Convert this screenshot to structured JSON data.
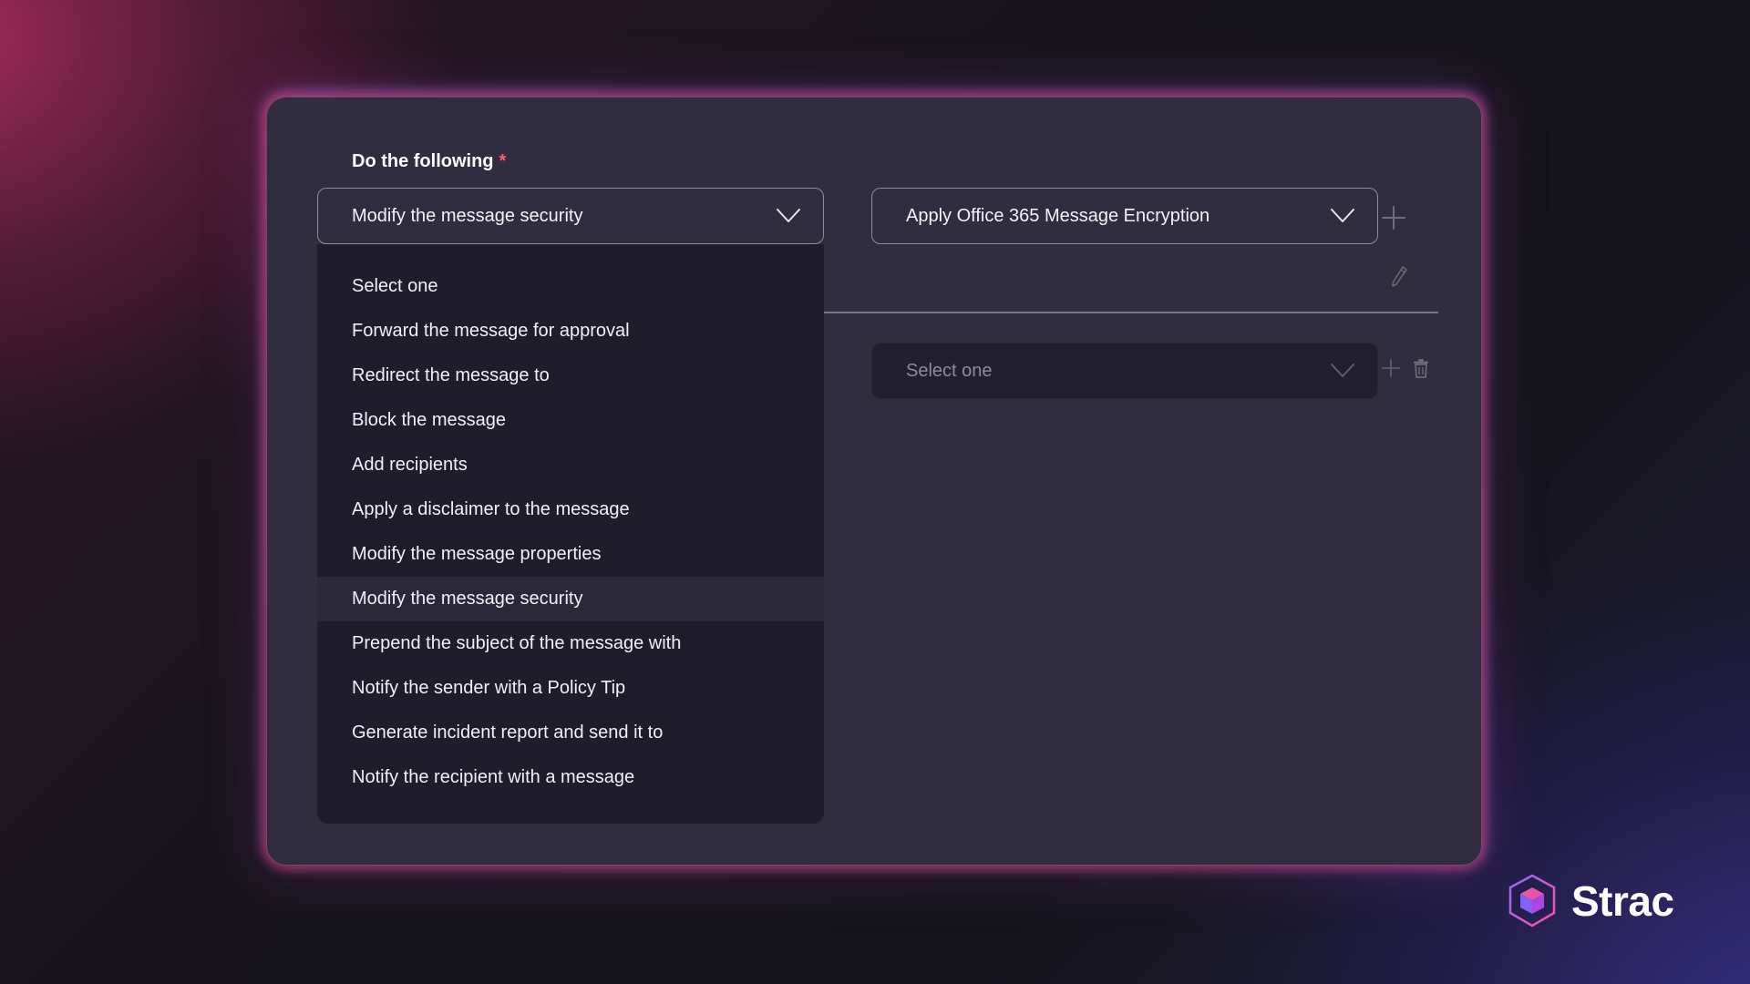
{
  "form": {
    "section_label": "Do the following",
    "required_marker": "*",
    "action_select": {
      "value": "Modify the message security",
      "state": "expanded"
    },
    "sub_action_select": {
      "value": "Apply Office 365 Message Encryption"
    },
    "empty_select": {
      "placeholder": "Select one"
    }
  },
  "dropdown": {
    "selected_index": 7,
    "items": [
      "Select one",
      "Forward the message for approval",
      "Redirect the message to",
      "Block the message",
      "Add recipients",
      "Apply a disclaimer to the message",
      "Modify the message properties",
      "Modify the message security",
      "Prepend the subject of the message with",
      "Notify the sender with a Policy Tip",
      "Generate incident report and send it to",
      "Notify the recipient with a message"
    ]
  },
  "icons": {
    "chevron": "chevron-down-icon",
    "add": "plus-icon",
    "edit": "pencil-icon",
    "delete": "trash-icon",
    "brand": "strac-logo"
  },
  "brand": {
    "name": "Strac"
  },
  "colors": {
    "card_background": "#302d40",
    "dropdown_background": "#1f1d2b",
    "selected_item": "#2a2839",
    "required": "#ff5a6e",
    "glow_pink": "#ec3e70",
    "glow_blue": "#786eff"
  }
}
